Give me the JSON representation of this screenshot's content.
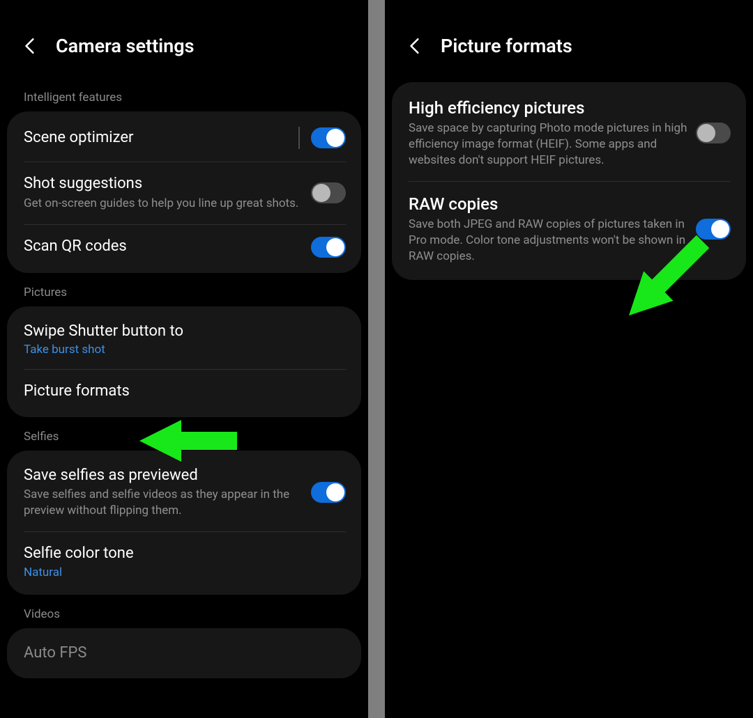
{
  "left": {
    "title": "Camera settings",
    "sections": [
      {
        "label": "Intelligent features",
        "rows": [
          {
            "title": "Scene optimizer",
            "toggle": "on",
            "vbar": true
          },
          {
            "title": "Shot suggestions",
            "desc": "Get on-screen guides to help you line up great shots.",
            "toggle": "off"
          },
          {
            "title": "Scan QR codes",
            "toggle": "on"
          }
        ]
      },
      {
        "label": "Pictures",
        "rows": [
          {
            "title": "Swipe Shutter button to",
            "value": "Take burst shot"
          },
          {
            "title": "Picture formats"
          }
        ]
      },
      {
        "label": "Selfies",
        "rows": [
          {
            "title": "Save selfies as previewed",
            "desc": "Save selfies and selfie videos as they appear in the preview without flipping them.",
            "toggle": "on"
          },
          {
            "title": "Selfie color tone",
            "value": "Natural"
          }
        ]
      },
      {
        "label": "Videos",
        "rows": [
          {
            "title": "Auto FPS",
            "toggle": "off"
          }
        ]
      }
    ]
  },
  "right": {
    "title": "Picture formats",
    "rows": [
      {
        "title": "High efficiency pictures",
        "desc": "Save space by capturing Photo mode pictures in high efficiency image format (HEIF). Some apps and websites don't support HEIF pictures.",
        "toggle": "off"
      },
      {
        "title": "RAW copies",
        "desc": "Save both JPEG and RAW copies of pictures taken in Pro mode. Color tone adjustments won't be shown in RAW copies.",
        "toggle": "on"
      }
    ]
  },
  "annotation_color": "#18e819"
}
